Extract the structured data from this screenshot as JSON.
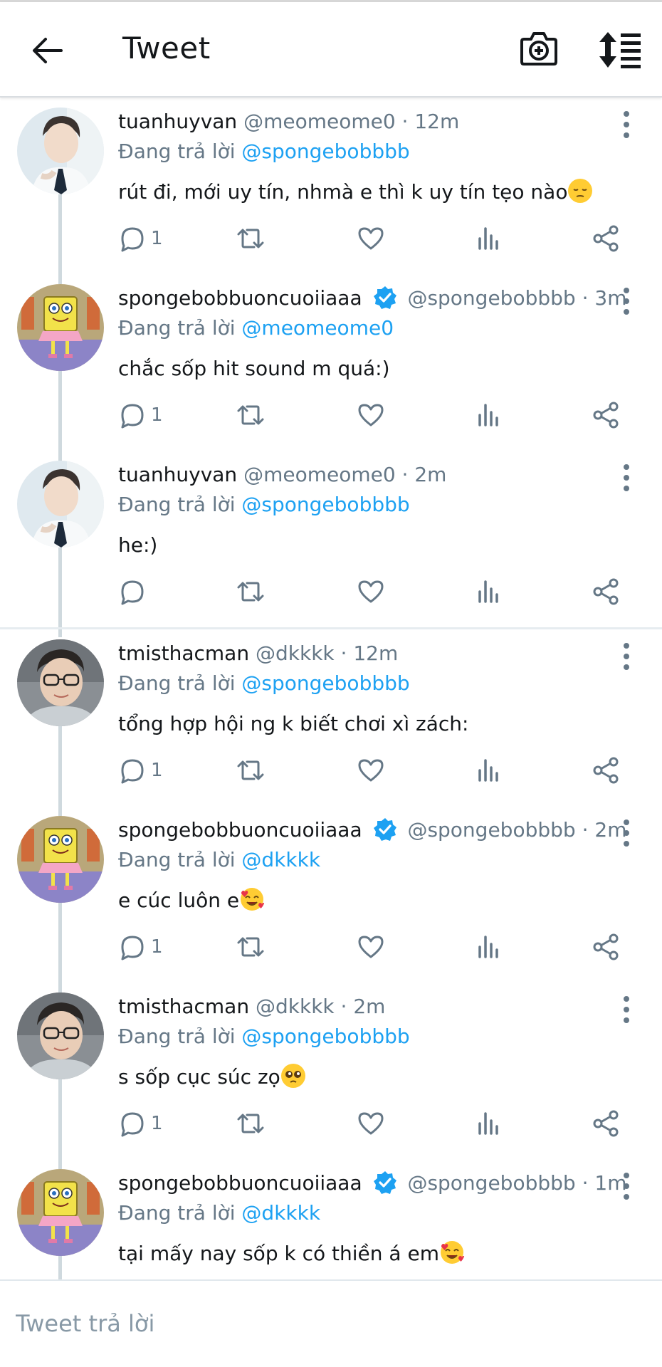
{
  "header": {
    "title": "Tweet",
    "back_icon": "arrow-left-icon",
    "camera_icon": "camera-plus-icon",
    "sort_icon": "sort-list-icon"
  },
  "tweets": [
    {
      "name": "tuanhuyvan",
      "verified": false,
      "handle_time": "@meomeome0 · 12m",
      "reply_prefix": "Đang trả lời",
      "reply_mention": "@spongebobbbb",
      "text": "rút đi, mới uy tín, nhmà e thì k uy tín tẹo nào",
      "emoji": "pensive-face",
      "reply_count": "1",
      "avatar": "boy-white-shirt"
    },
    {
      "name": "spongebobbuoncuoiiaaa",
      "verified": true,
      "handle_time": "@spongebobbbb · 3m",
      "reply_prefix": "Đang trả lời",
      "reply_mention": "@meomeome0",
      "text": "chắc sốp hit sound m quá:)",
      "emoji": "",
      "reply_count": "1",
      "avatar": "spongebob"
    },
    {
      "name": "tuanhuyvan",
      "verified": false,
      "handle_time": "@meomeome0 · 2m",
      "reply_prefix": "Đang trả lời",
      "reply_mention": "@spongebobbbb",
      "text": "he:)",
      "emoji": "",
      "reply_count": "",
      "avatar": "boy-white-shirt"
    },
    {
      "name": "tmisthacman",
      "verified": false,
      "handle_time": "@dkkkk · 12m",
      "reply_prefix": "Đang trả lời",
      "reply_mention": "@spongebobbbb",
      "text": "tổng hợp hội ng k biết chơi xì zách:",
      "emoji": "",
      "reply_count": "1",
      "avatar": "boy-glasses"
    },
    {
      "name": "spongebobbuoncuoiiaaa",
      "verified": true,
      "handle_time": "@spongebobbbb · 2m",
      "reply_prefix": "Đang trả lời",
      "reply_mention": "@dkkkk",
      "text": "e cúc luôn e",
      "emoji": "smiling-face-with-hearts",
      "reply_count": "1",
      "avatar": "spongebob"
    },
    {
      "name": "tmisthacman",
      "verified": false,
      "handle_time": "@dkkkk · 2m",
      "reply_prefix": "Đang trả lời",
      "reply_mention": "@spongebobbbb",
      "text": "s sốp cục súc zọ",
      "emoji": "pleading-face",
      "reply_count": "1",
      "avatar": "boy-glasses"
    },
    {
      "name": "spongebobbuoncuoiiaaa",
      "verified": true,
      "handle_time": "@spongebobbbb · 1m",
      "reply_prefix": "Đang trả lời",
      "reply_mention": "@dkkkk",
      "text": "tại mấy nay sốp k có thiền á em",
      "emoji": "smiling-face-with-hearts",
      "reply_count": "",
      "avatar": "spongebob"
    }
  ],
  "reply_bar": {
    "placeholder": "Tweet trả lời"
  },
  "colors": {
    "accent": "#1da1f2",
    "secondary_text": "#657786",
    "icon": "#657786",
    "thread_line": "#cfd9de"
  }
}
